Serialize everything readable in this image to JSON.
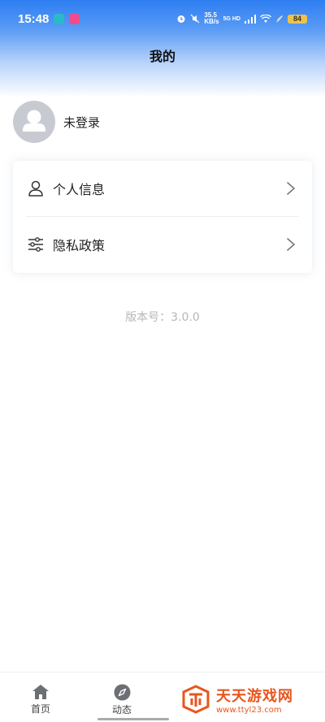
{
  "status_bar": {
    "time": "15:48",
    "net_speed_value": "35.5",
    "net_speed_unit": "KB/s",
    "network": "5G HD",
    "battery": "84"
  },
  "header": {
    "title": "我的"
  },
  "profile": {
    "login_status": "未登录"
  },
  "menu": {
    "items": [
      {
        "label": "个人信息",
        "icon": "user-icon"
      },
      {
        "label": "隐私政策",
        "icon": "sliders-icon"
      }
    ]
  },
  "version_text": "版本号：3.0.0",
  "tabbar": {
    "tabs": [
      {
        "label": "首页",
        "icon": "home-icon"
      },
      {
        "label": "动态",
        "icon": "compass-icon"
      }
    ]
  },
  "watermark": {
    "title": "天天游戏网",
    "url": "www.ttyl23.com"
  },
  "colors": {
    "accent": "#2d7ef2",
    "watermark": "#e8561d"
  }
}
